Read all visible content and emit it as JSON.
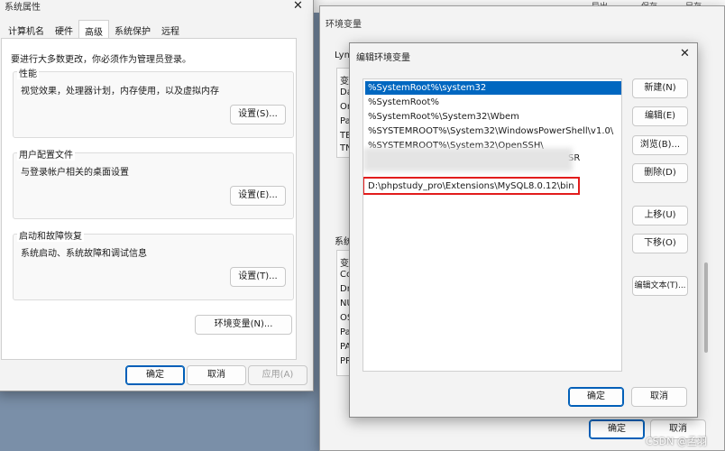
{
  "sysprop": {
    "title": "系统属性",
    "tabs": [
      "计算机名",
      "硬件",
      "高级",
      "系统保护",
      "远程"
    ],
    "admin_note": "要进行大多数更改，你必须作为管理员登录。",
    "groups": [
      {
        "title": "性能",
        "desc": "视觉效果，处理器计划，内存使用，以及虚拟内存",
        "button": "设置(S)..."
      },
      {
        "title": "用户配置文件",
        "desc": "与登录帐户相关的桌面设置",
        "button": "设置(E)..."
      },
      {
        "title": "启动和故障恢复",
        "desc": "系统启动、系统故障和调试信息",
        "button": "设置(T)..."
      }
    ],
    "env_button": "环境变量(N)...",
    "ok": "确定",
    "cancel": "取消",
    "apply": "应用(A)"
  },
  "envwin": {
    "title": "环境变量",
    "user_section": "Lynx",
    "user_frags": [
      "变",
      "Da",
      "On",
      "Pa",
      "TE",
      "TN"
    ],
    "sys_section": "系统",
    "sys_frags": [
      "变",
      "Co",
      "Dr",
      "NU",
      "OS",
      "Pa",
      "PA",
      "PR"
    ],
    "ok": "确定",
    "cancel": "取消",
    "toolbar_labels": [
      "导出",
      "保存",
      "另存"
    ]
  },
  "editdlg": {
    "title": "编辑环境变量",
    "paths": [
      "%SystemRoot%\\system32",
      "%SystemRoot%",
      "%SystemRoot%\\System32\\Wbem",
      "%SYSTEMROOT%\\System32\\WindowsPowerShell\\v1.0\\",
      "%SYSTEMROOT%\\System32\\OpenSSH\\",
      "SR",
      "",
      "D:\\phpstudy_pro\\Extensions\\MySQL8.0.12\\bin"
    ],
    "buttons": {
      "new": "新建(N)",
      "edit": "编辑(E)",
      "browse": "浏览(B)...",
      "delete": "删除(D)",
      "up": "上移(U)",
      "down": "下移(O)",
      "edit_text": "编辑文本(T)..."
    },
    "ok": "确定",
    "cancel": "取消"
  },
  "watermark": "CSDN @孟羽"
}
